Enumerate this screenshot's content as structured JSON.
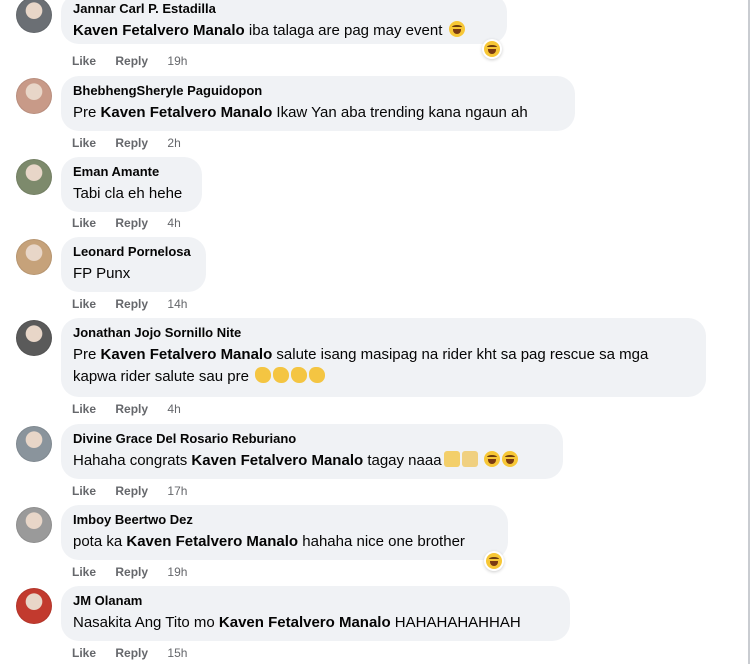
{
  "comments": [
    {
      "author": "Jannar Carl P. Estadilla",
      "mention": "Kaven Fetalvero Manalo",
      "text_before": "",
      "text_after": " iba talaga are pag may event",
      "like": "Like",
      "reply": "Reply",
      "time": "19h",
      "avatar_color": "#6b6f74"
    },
    {
      "author": "BhebhengSheryle Paguidopon",
      "mention": "Kaven Fetalvero Manalo",
      "text_before": "Pre ",
      "text_after": " Ikaw Yan aba trending kana ngaun ah",
      "like": "Like",
      "reply": "Reply",
      "time": "2h",
      "avatar_color": "#c89a88"
    },
    {
      "author": "Eman Amante",
      "text": "Tabi cla eh hehe",
      "like": "Like",
      "reply": "Reply",
      "time": "4h",
      "avatar_color": "#7d8a6c"
    },
    {
      "author": "Leonard Pornelosa",
      "text": "FP Punx",
      "like": "Like",
      "reply": "Reply",
      "time": "14h",
      "avatar_color": "#c6a27a"
    },
    {
      "author": "Jonathan Jojo Sornillo Nite",
      "mention": "Kaven Fetalvero Manalo",
      "text_before": "Pre ",
      "text_after": " salute isang masipag na rider kht sa pag rescue sa mga kapwa rider salute sau pre",
      "like": "Like",
      "reply": "Reply",
      "time": "4h",
      "avatar_color": "#5a5a5a"
    },
    {
      "author": "Divine Grace Del Rosario Reburiano",
      "mention": "Kaven Fetalvero Manalo",
      "text_before": "Hahaha congrats ",
      "text_after": " tagay naaa",
      "like": "Like",
      "reply": "Reply",
      "time": "17h",
      "avatar_color": "#8a949c"
    },
    {
      "author": "Imboy Beertwo Dez",
      "mention": "Kaven Fetalvero Manalo",
      "text_before": "pota ka ",
      "text_after": " hahaha nice one brother",
      "like": "Like",
      "reply": "Reply",
      "time": "19h",
      "avatar_color": "#9a9a9a"
    },
    {
      "author": "JM Olanam",
      "mention": "Kaven Fetalvero Manalo",
      "text_before": "Nasakita Ang Tito mo ",
      "text_after": " HAHAHAHAHHAH",
      "like": "Like",
      "reply": "Reply",
      "time": "15h",
      "avatar_color": "#c23a2e"
    }
  ]
}
